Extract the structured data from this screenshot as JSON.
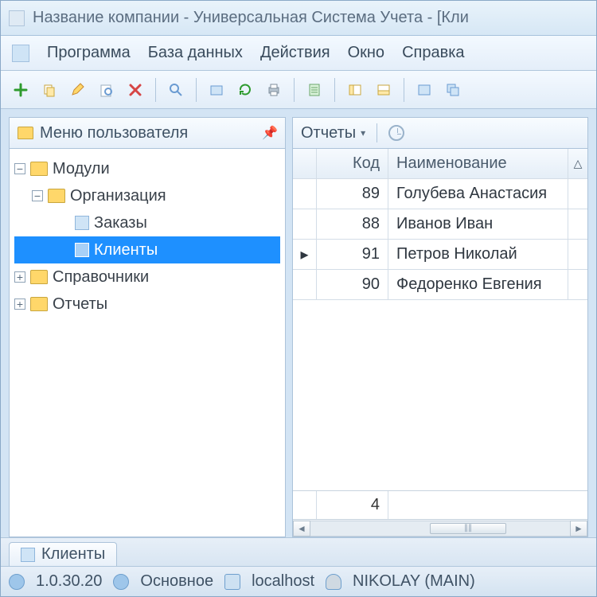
{
  "title": "Название компании - Универсальная Система Учета - [Кли",
  "menu": {
    "items": [
      "Программа",
      "База данных",
      "Действия",
      "Окно",
      "Справка"
    ]
  },
  "toolbar": {
    "icons": [
      "plus",
      "copy",
      "edit",
      "find",
      "delete",
      "sep",
      "zoom",
      "sep",
      "object",
      "refresh",
      "print",
      "sep",
      "props",
      "sep",
      "pane",
      "pane2",
      "sep",
      "win1",
      "win2"
    ]
  },
  "leftpanel": {
    "title": "Меню пользователя",
    "tree": {
      "modules": "Модули",
      "organization": "Организация",
      "orders": "Заказы",
      "clients": "Клиенты",
      "dictionaries": "Справочники",
      "reports": "Отчеты"
    }
  },
  "rightpanel": {
    "dropdown": "Отчеты",
    "columns": {
      "code": "Код",
      "name": "Наименование"
    },
    "rows": [
      {
        "code": "89",
        "name": "Голубева Анастасия"
      },
      {
        "code": "88",
        "name": "Иванов Иван"
      },
      {
        "code": "91",
        "name": "Петров Николай"
      },
      {
        "code": "90",
        "name": "Федоренко Евгения"
      }
    ],
    "footer_count": "4"
  },
  "tab": {
    "label": "Клиенты"
  },
  "status": {
    "version": "1.0.30.20",
    "db": "Основное",
    "host": "localhost",
    "user": "NIKOLAY (MAIN)"
  }
}
